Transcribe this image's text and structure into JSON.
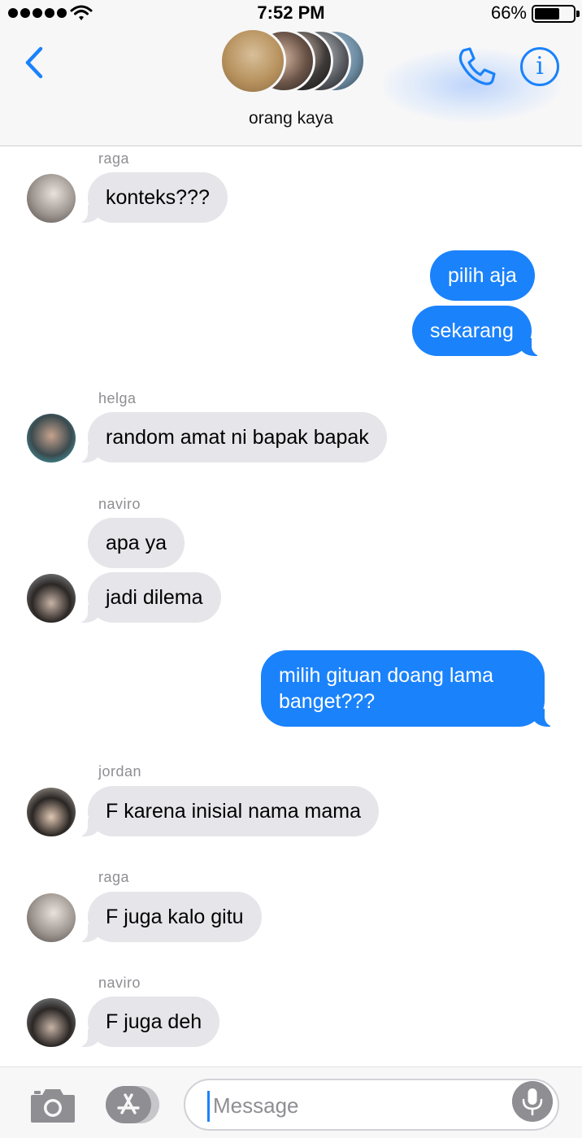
{
  "status_bar": {
    "time": "7:52 PM",
    "battery_percent": "66%",
    "battery_level": 0.66,
    "signal_bars": 5
  },
  "header": {
    "group_name": "orang kaya",
    "icons": {
      "back": "chevron-left-icon",
      "call": "phone-icon",
      "info": "info-icon"
    },
    "info_glyph": "i",
    "accent_color": "#1a82fb"
  },
  "thread": [
    {
      "kind": "sender",
      "text": "raga"
    },
    {
      "kind": "incoming",
      "text": "konteks???"
    },
    {
      "kind": "outgoing",
      "text": "pilih aja"
    },
    {
      "kind": "outgoing",
      "text": "sekarang"
    },
    {
      "kind": "sender",
      "text": "helga"
    },
    {
      "kind": "incoming",
      "text": "random amat ni bapak bapak"
    },
    {
      "kind": "sender",
      "text": "naviro"
    },
    {
      "kind": "incoming",
      "text": "apa ya"
    },
    {
      "kind": "incoming",
      "text": "jadi dilema"
    },
    {
      "kind": "outgoing",
      "text": "milih gituan doang lama banget???"
    },
    {
      "kind": "sender",
      "text": "jordan"
    },
    {
      "kind": "incoming",
      "text": "F karena inisial nama mama"
    },
    {
      "kind": "sender",
      "text": "raga"
    },
    {
      "kind": "incoming",
      "text": "F juga kalo gitu"
    },
    {
      "kind": "sender",
      "text": "naviro"
    },
    {
      "kind": "incoming",
      "text": "F juga deh"
    }
  ],
  "composer": {
    "placeholder": "Message",
    "icons": {
      "camera": "camera-icon",
      "apps": "app-store-icon",
      "mic": "microphone-icon"
    }
  },
  "colors": {
    "outgoing_bubble": "#1a82fb",
    "incoming_bubble": "#e5e5ea",
    "sender_label": "#8e8e93"
  }
}
